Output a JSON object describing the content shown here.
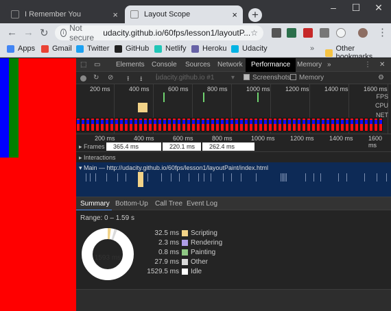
{
  "browser": {
    "tabs": [
      {
        "title": "I Remember You",
        "active": false
      },
      {
        "title": "Layout Scope",
        "active": true
      }
    ],
    "new_tab": "+",
    "window_controls": {
      "minimize": "–",
      "maximize": "☐",
      "close": "✕"
    },
    "security_label": "Not secure",
    "url": "udacity.github.io/60fps/lesson1/layoutP...",
    "bookmarks": [
      {
        "label": "Apps",
        "icon": "apps-icon",
        "color": "#4285f4"
      },
      {
        "label": "Gmail",
        "icon": "gmail-icon",
        "color": "#ea4335"
      },
      {
        "label": "Twitter",
        "icon": "twitter-icon",
        "color": "#1da1f2"
      },
      {
        "label": "GitHub",
        "icon": "github-icon",
        "color": "#222222"
      },
      {
        "label": "Netlify",
        "icon": "netlify-icon",
        "color": "#20c6b7"
      },
      {
        "label": "Heroku",
        "icon": "heroku-icon",
        "color": "#6762a6"
      },
      {
        "label": "Udacity",
        "icon": "udacity-icon",
        "color": "#02b3e4"
      }
    ],
    "bookmarks_more": "»",
    "other_bookmarks": "Other bookmarks"
  },
  "page": {
    "colors": {
      "background": "#ff0000",
      "stripe1": "#0000ff",
      "stripe2": "#008000"
    }
  },
  "devtools": {
    "tabs": [
      "Elements",
      "Console",
      "Sources",
      "Network",
      "Performance",
      "Memory"
    ],
    "active_tab": "Performance",
    "more_tabs": "»",
    "recording_select": "udacity.github.io #1",
    "screenshots_label": "Screenshots",
    "screenshots_checked": true,
    "memory_label": "Memory",
    "memory_checked": false,
    "overview_ticks": [
      "200 ms",
      "400 ms",
      "600 ms",
      "800 ms",
      "1000 ms",
      "1200 ms",
      "1400 ms",
      "1600 ms"
    ],
    "overview_labels": {
      "fps": "FPS",
      "cpu": "CPU",
      "net": "NET"
    },
    "ruler_ticks": [
      "200 ms",
      "400 ms",
      "600 ms",
      "800 ms",
      "1000 ms",
      "1200 ms",
      "1400 ms",
      "1600 ms"
    ],
    "frames_label": "Frames",
    "frame_durations": [
      "365.4 ms",
      "220.1 ms",
      "262.4 ms"
    ],
    "interactions_label": "Interactions",
    "main_label": "Main — http://udacity.github.io/60fps/lesson1/layoutPaint/index.html",
    "summary_tabs": [
      "Summary",
      "Bottom-Up",
      "Call Tree",
      "Event Log"
    ],
    "active_summary_tab": "Summary",
    "range": "Range: 0 – 1.59 s",
    "total": "1593 ms",
    "breakdown": [
      {
        "value": "32.5 ms",
        "label": "Scripting",
        "color": "#f2d388"
      },
      {
        "value": "2.3 ms",
        "label": "Rendering",
        "color": "#af9ee6"
      },
      {
        "value": "0.8 ms",
        "label": "Painting",
        "color": "#8fc784"
      },
      {
        "value": "27.9 ms",
        "label": "Other",
        "color": "#dadada"
      },
      {
        "value": "1529.5 ms",
        "label": "Idle",
        "color": "#ffffff"
      }
    ]
  }
}
